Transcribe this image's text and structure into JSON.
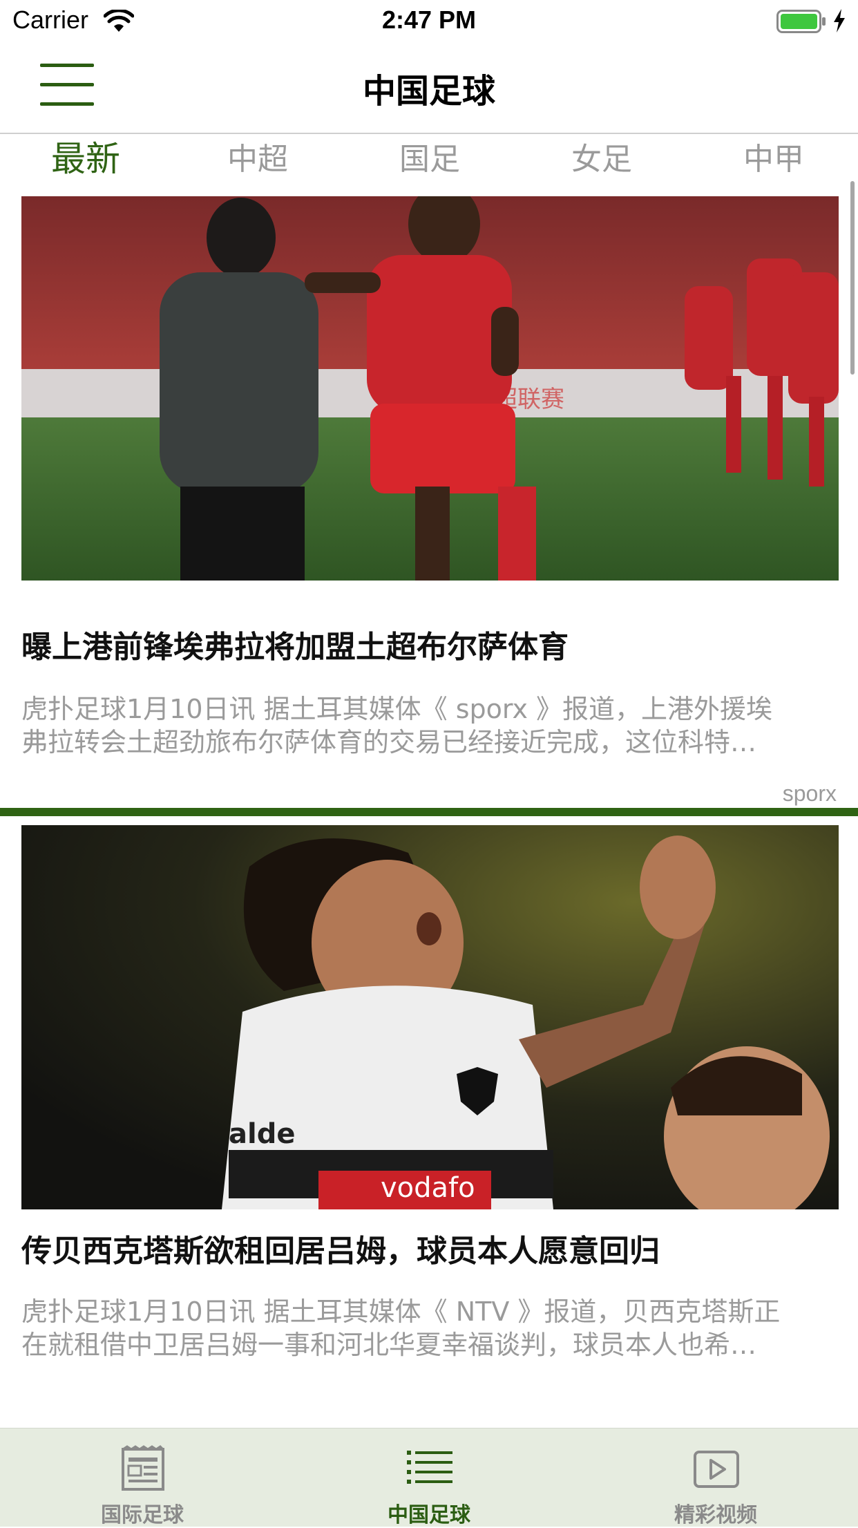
{
  "status_bar": {
    "carrier": "Carrier",
    "time": "2:47 PM"
  },
  "nav": {
    "title": "中国足球",
    "menu_icon": "hamburger-menu-icon"
  },
  "tabs": [
    {
      "label": "最新",
      "active": true
    },
    {
      "label": "中超",
      "active": false
    },
    {
      "label": "国足",
      "active": false
    },
    {
      "label": "女足",
      "active": false
    },
    {
      "label": "中甲",
      "active": false
    }
  ],
  "articles": [
    {
      "title": "曝上港前锋埃弗拉将加盟土超布尔萨体育",
      "summary_line1": "虎扑足球1月10日讯 据土耳其媒体《 sporx 》报道，上港外援埃",
      "summary_line2": "弗拉转会土超劲旅布尔萨体育的交易已经接近完成，这位科特…",
      "source": "sporx",
      "image": "soccer-celebration-photo"
    },
    {
      "title": "传贝西克塔斯欲租回居吕姆，球员本人愿意回归",
      "summary_line1": "虎扑足球1月10日讯 据土耳其媒体《 NTV 》报道，贝西克塔斯正",
      "summary_line2": "在就租借中卫居吕姆一事和河北华夏幸福谈判，球员本人也希…",
      "image": "footballer-cheering-photo"
    }
  ],
  "tab_bar": [
    {
      "label": "国际足球",
      "icon": "newspaper-icon",
      "active": false
    },
    {
      "label": "中国足球",
      "icon": "list-icon",
      "active": true
    },
    {
      "label": "精彩视频",
      "icon": "video-play-icon",
      "active": false
    }
  ],
  "colors": {
    "accent": "#2f6314",
    "tab_bar_bg": "#e6ece0",
    "muted_text": "#9a9a9a"
  }
}
